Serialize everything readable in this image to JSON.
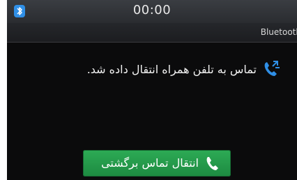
{
  "status_bar": {
    "time": "00:00",
    "bluetooth_icon": "bluetooth-icon"
  },
  "title_bar": {
    "title": "Bluetooth"
  },
  "message": {
    "text": "تماس به تلفن همراه انتقال داده شد.",
    "icon": "call-transfer-icon"
  },
  "action": {
    "label": "انتقال تماس برگشتی",
    "icon": "phone-icon"
  },
  "colors": {
    "accent_blue": "#2f8fe6",
    "button_green": "#23a04b"
  }
}
